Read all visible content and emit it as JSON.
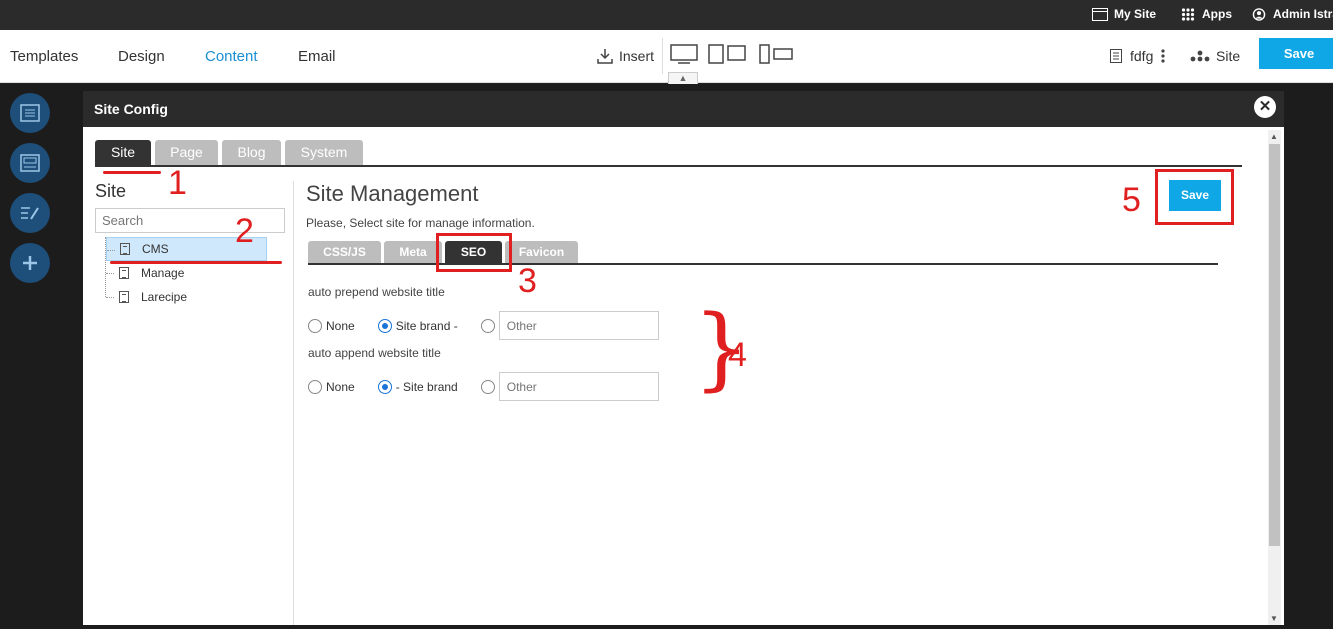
{
  "topbar": {
    "my_site": "My Site",
    "apps": "Apps",
    "admin": "Admin Istra"
  },
  "toolbar": {
    "nav": [
      "Templates",
      "Design",
      "Content",
      "Email"
    ],
    "active_nav": "Content",
    "insert": "Insert",
    "page_name": "fdfg",
    "site": "Site",
    "save": "Save"
  },
  "modal": {
    "title": "Site Config",
    "close_icon": "close-icon",
    "tabs": [
      "Site",
      "Page",
      "Blog",
      "System"
    ],
    "active_tab": "Site",
    "left": {
      "title": "Site",
      "search_placeholder": "Search",
      "tree": [
        "CMS",
        "Manage",
        "Larecipe"
      ],
      "selected": "CMS"
    },
    "right": {
      "title": "Site Management",
      "description": "Please, Select site for manage information.",
      "subtabs": [
        "CSS/JS",
        "Meta",
        "SEO",
        "Favicon"
      ],
      "active_subtab": "SEO",
      "save": "Save",
      "prepend": {
        "label": "auto prepend website title",
        "options": [
          "None",
          "Site brand -"
        ],
        "selected": "Site brand -",
        "other_placeholder": "Other"
      },
      "append": {
        "label": "auto append website title",
        "options": [
          "None",
          "- Site brand"
        ],
        "selected": "- Site brand",
        "other_placeholder": "Other"
      }
    }
  },
  "annotations": [
    "1",
    "2",
    "3",
    "4",
    "5"
  ],
  "colors": {
    "accent": "#10a7e6",
    "annotation": "#e02020",
    "dark": "#2b2b2b"
  }
}
